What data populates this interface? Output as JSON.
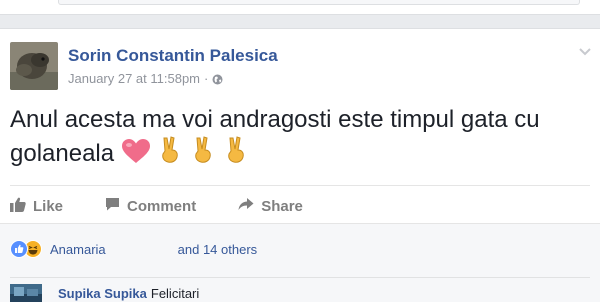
{
  "post": {
    "author": "Sorin Constantin Palesica",
    "timestamp": "January 27 at 11:58pm",
    "separator": "·",
    "privacy_icon": "globe-icon",
    "text": "Anul acesta ma voi andragosti este timpul gata cu golaneala"
  },
  "actions": {
    "like_label": "Like",
    "comment_label": "Comment",
    "share_label": "Share"
  },
  "reactions": {
    "icons": [
      "like-reaction-icon",
      "haha-reaction-icon"
    ],
    "name": "Anamaria",
    "others": "and 14 others"
  },
  "comment": {
    "author": "Supika Supika",
    "text": "Felicitari"
  },
  "colors": {
    "link": "#365899",
    "text": "#1d2129",
    "meta": "#90949c",
    "action": "#7f7f7f",
    "heart": "#f06c8a",
    "hand": "#f5b942"
  }
}
